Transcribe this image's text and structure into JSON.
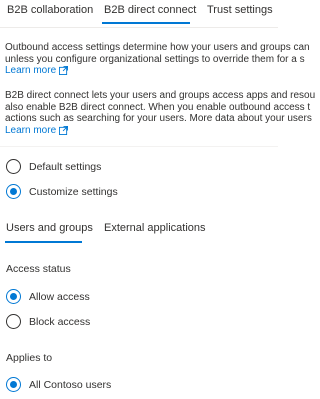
{
  "tabs": [
    "B2B collaboration",
    "B2B direct connect",
    "Trust settings"
  ],
  "intro": {
    "line1": "Outbound access settings determine how your users and groups can",
    "line2": "unless you configure organizational settings to override them for a s",
    "learn_more": "Learn more"
  },
  "description": {
    "line1": "B2B direct connect lets your users and groups access apps and resou",
    "line2": "also enable B2B direct connect. When you enable outbound access t",
    "line3": "actions such as searching for your users. More data about your users",
    "learn_more": "Learn more"
  },
  "settings_mode": {
    "options": [
      "Default settings",
      "Customize settings"
    ],
    "selected": "Customize settings"
  },
  "subtabs": [
    "Users and groups",
    "External applications"
  ],
  "access_status": {
    "label": "Access status",
    "options": [
      "Allow access",
      "Block access"
    ],
    "selected": "Allow access"
  },
  "applies_to": {
    "label": "Applies to",
    "options": [
      "All Contoso users"
    ],
    "selected": "All Contoso users"
  },
  "colors": {
    "accent": "#0078d4",
    "text": "#323130"
  }
}
